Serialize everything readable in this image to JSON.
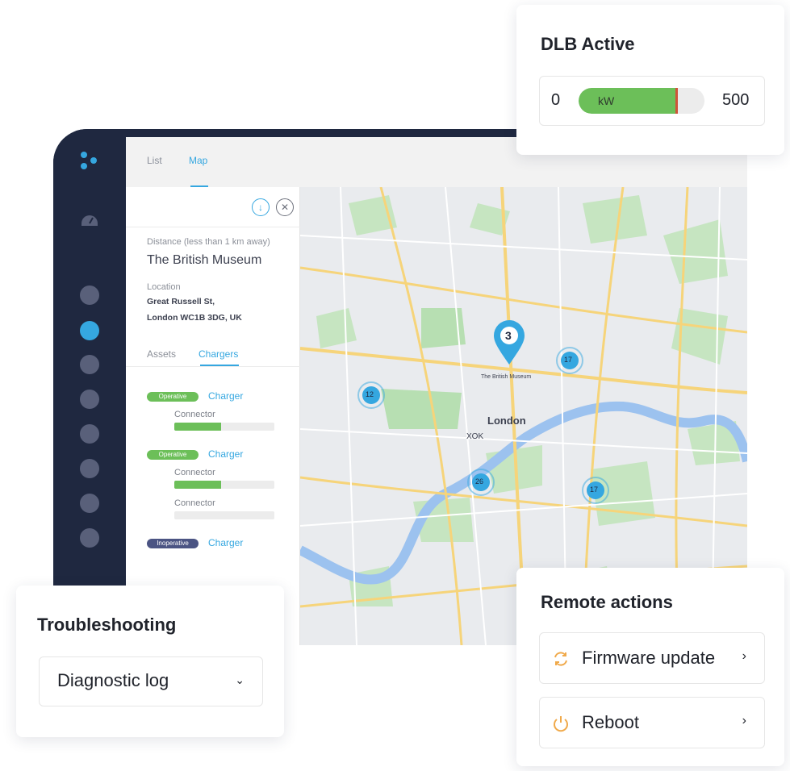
{
  "app": {
    "tabs": [
      {
        "label": "List"
      },
      {
        "label": "Map"
      }
    ],
    "active_tab": "Map"
  },
  "panel": {
    "distance_label": "Distance (less than 1 km away)",
    "place_name": "The British Museum",
    "location_label": "Location",
    "address_line1": "Great Russell St,",
    "address_line2": "London WC1B 3DG, UK",
    "tabs": [
      {
        "label": "Assets"
      },
      {
        "label": "Chargers"
      }
    ],
    "active_tab": "Chargers",
    "chargers": [
      {
        "status": "Operative",
        "status_color": "#6cbf59",
        "label": "Charger",
        "connectors": [
          {
            "label": "Connector",
            "level": 0.47
          }
        ]
      },
      {
        "status": "Operative",
        "status_color": "#6cbf59",
        "label": "Charger",
        "connectors": [
          {
            "label": "Connector",
            "level": 0.47
          },
          {
            "label": "Connector",
            "level": 0
          }
        ]
      },
      {
        "status": "Inoperative",
        "status_color": "#4b5483",
        "label": "Charger",
        "connectors": []
      }
    ]
  },
  "map": {
    "city_label": "London",
    "landmark_label": "The British Museum",
    "landmark_small": "XOK",
    "pin_count": "3",
    "clusters": [
      {
        "count": "12"
      },
      {
        "count": "17"
      },
      {
        "count": "26"
      },
      {
        "count": "17"
      }
    ]
  },
  "dlb": {
    "title": "DLB Active",
    "min": "0",
    "max": "500",
    "unit": "kW",
    "level": 0.78
  },
  "troubleshooting": {
    "title": "Troubleshooting",
    "selected": "Diagnostic log"
  },
  "remote": {
    "title": "Remote actions",
    "actions": [
      {
        "label": "Firmware update",
        "icon": "refresh-icon"
      },
      {
        "label": "Reboot",
        "icon": "power-icon"
      }
    ]
  },
  "colors": {
    "accent": "#35a7e0",
    "operative": "#6cbf59",
    "inoperative": "#4b5483",
    "frame": "#1f2840",
    "marker": "#d0533a"
  }
}
